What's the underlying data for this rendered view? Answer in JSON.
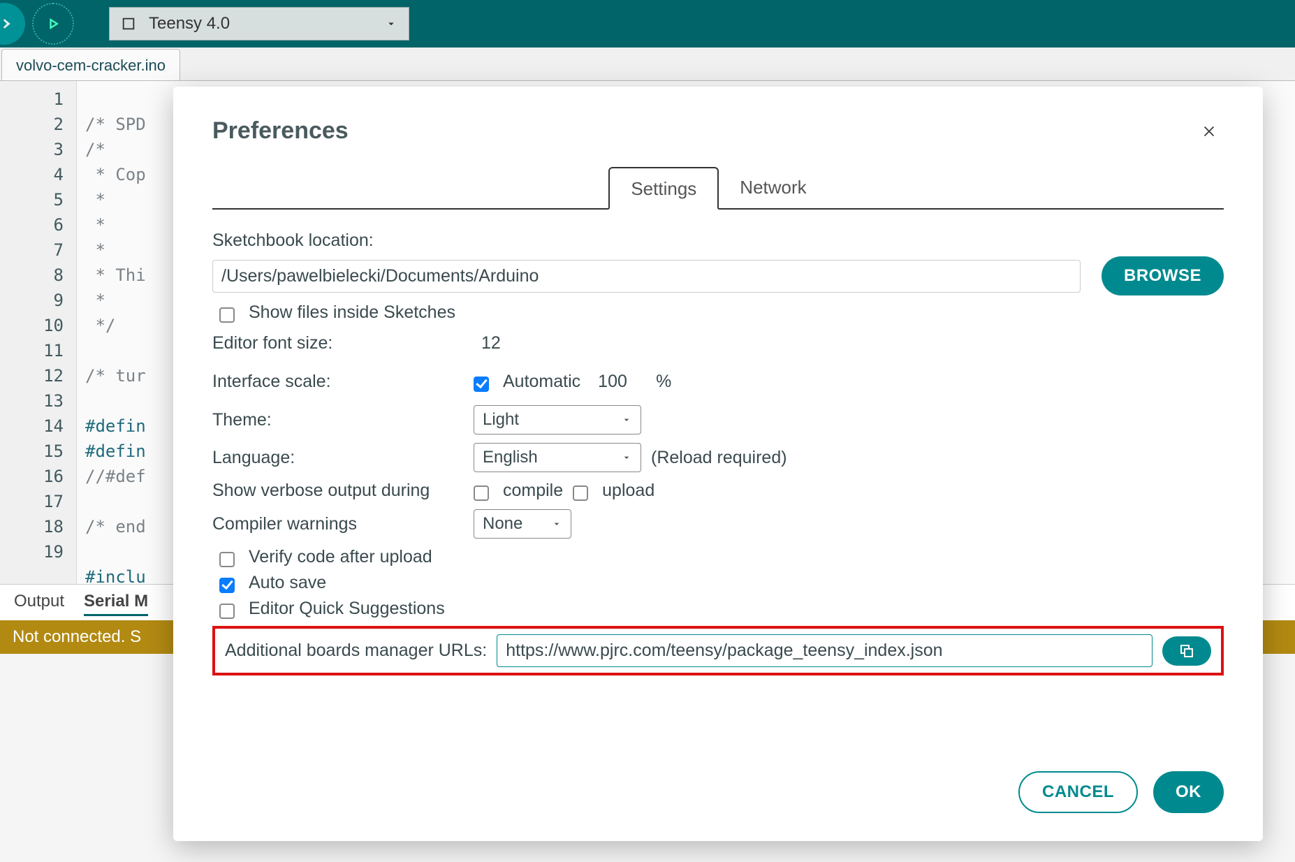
{
  "toolbar": {
    "board_label": "Teensy 4.0"
  },
  "editor_tab": "volvo-cem-cracker.ino",
  "code_lines": {
    "n": [
      "1",
      "2",
      "3",
      "4",
      "5",
      "6",
      "7",
      "8",
      "9",
      "10",
      "11",
      "12",
      "13",
      "14",
      "15",
      "16",
      "17",
      "18",
      "19"
    ],
    "l1": "/* SPD",
    "l2": "/*",
    "l3": " * Cop",
    "l4": " *",
    "l5": " *",
    "l6": " *",
    "l7": " * Thi",
    "l8": " *",
    "l9": " */",
    "l10": "",
    "l11": "/* tur",
    "l12": "",
    "l13": "#defin",
    "l14": "#defin",
    "l15": "//#def",
    "l16": "",
    "l17": "/* end",
    "l18": "",
    "l19": "#inclu"
  },
  "panel": {
    "output": "Output",
    "serial": "Serial M",
    "status": "Not connected. S"
  },
  "modal": {
    "title": "Preferences",
    "tabs": {
      "settings": "Settings",
      "network": "Network"
    },
    "sketchbook_label": "Sketchbook location:",
    "sketchbook_value": "/Users/pawelbielecki/Documents/Arduino",
    "browse": "BROWSE",
    "show_files": "Show files inside Sketches",
    "font_size_label": "Editor font size:",
    "font_size_value": "12",
    "interface_scale_label": "Interface scale:",
    "automatic": "Automatic",
    "scale_value": "100",
    "scale_pct": "%",
    "theme_label": "Theme:",
    "theme_value": "Light",
    "language_label": "Language:",
    "language_value": "English",
    "reload_note": "(Reload required)",
    "verbose_label": "Show verbose output during",
    "verbose_compile": "compile",
    "verbose_upload": "upload",
    "warnings_label": "Compiler warnings",
    "warnings_value": "None",
    "verify_after_upload": "Verify code after upload",
    "auto_save": "Auto save",
    "quick_suggestions": "Editor Quick Suggestions",
    "boards_urls_label": "Additional boards manager URLs:",
    "boards_urls_value": "https://www.pjrc.com/teensy/package_teensy_index.json",
    "cancel": "CANCEL",
    "ok": "OK"
  }
}
